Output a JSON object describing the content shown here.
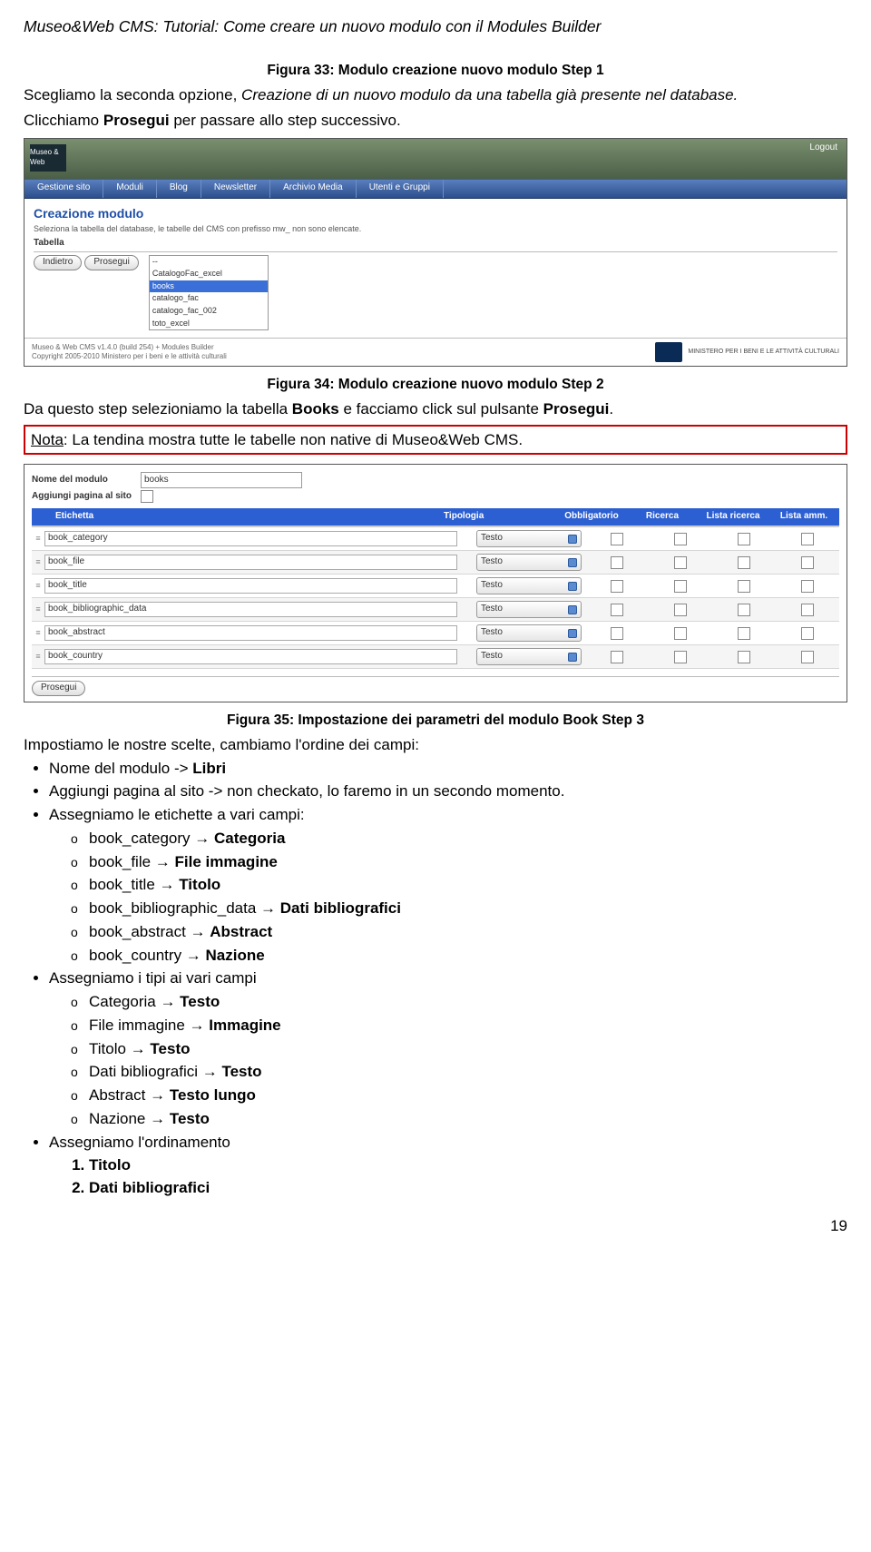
{
  "header": "Museo&Web CMS: Tutorial: Come creare un nuovo modulo con il Modules Builder",
  "fig33": "Figura 33: Modulo creazione nuovo modulo Step 1",
  "para1a": "Scegliamo la seconda opzione, ",
  "para1b": "Creazione di un nuovo modulo da una tabella già presente nel database.",
  "para2a": "Clicchiamo ",
  "para2b": "Prosegui",
  "para2c": " per passare allo step successivo.",
  "shot1": {
    "logo": "Museo & Web",
    "logout": "Logout",
    "nav": [
      "Gestione sito",
      "Moduli",
      "Blog",
      "Newsletter",
      "Archivio Media",
      "Utenti e Gruppi"
    ],
    "title": "Creazione modulo",
    "sub": "Seleziona la tabella del database, le tabelle del CMS con prefisso mw_ non sono elencate.",
    "label": "Tabella",
    "btn_back": "Indietro",
    "btn_next": "Prosegui",
    "dd_sel": "--",
    "dd_opts": [
      "CatalogoFac_excel",
      "books",
      "catalogo_fac",
      "catalogo_fac_002",
      "toto_excel"
    ],
    "footer_l1": "Museo & Web CMS v1.4.0 (build 254) + Modules Builder",
    "footer_l2": "Copyright 2005-2010 Ministero per i beni e le attività culturali",
    "mibac": "MINISTERO PER I BENI E LE ATTIVITÀ CULTURALI"
  },
  "fig34": "Figura 34: Modulo creazione nuovo modulo Step 2",
  "para3a": "Da questo step selezioniamo la tabella ",
  "para3b": "Books",
  "para3c": " e facciamo click sul pulsante ",
  "para3d": "Prosegui",
  "para3e": ".",
  "note_a": "Nota",
  "note_b": ": La tendina mostra tutte le tabelle non native di Museo&Web CMS.",
  "shot2": {
    "lbl_nome": "Nome del modulo",
    "val_nome": "books",
    "lbl_agg": "Aggiungi pagina al sito",
    "head": {
      "et": "Etichetta",
      "tp": "Tipologia",
      "ob": "Obbligatorio",
      "ri": "Ricerca",
      "lr": "Lista ricerca",
      "la": "Lista amm."
    },
    "rows": [
      {
        "et": "book_category",
        "tp": "Testo"
      },
      {
        "et": "book_file",
        "tp": "Testo"
      },
      {
        "et": "book_title",
        "tp": "Testo"
      },
      {
        "et": "book_bibliographic_data",
        "tp": "Testo"
      },
      {
        "et": "book_abstract",
        "tp": "Testo"
      },
      {
        "et": "book_country",
        "tp": "Testo"
      }
    ],
    "btn": "Prosegui"
  },
  "fig35": "Figura 35: Impostazione dei parametri del modulo Book Step 3",
  "para4": "Impostiamo le nostre scelte, cambiamo l'ordine dei campi:",
  "b1a": "Nome del modulo -> ",
  "b1b": "Libri",
  "b2": "Aggiungi pagina al sito -> non checkato, lo faremo in un secondo momento.",
  "b3": "Assegniamo le etichette a vari campi:",
  "b3_items": [
    {
      "l": "book_category",
      "r": "Categoria"
    },
    {
      "l": "book_file",
      "r": "File immagine"
    },
    {
      "l": "book_title",
      "r": "Titolo"
    },
    {
      "l": "book_bibliographic_data",
      "r": "Dati bibliografici"
    },
    {
      "l": "book_abstract",
      "r": "Abstract"
    },
    {
      "l": "book_country",
      "r": "Nazione"
    }
  ],
  "b4": "Assegniamo i tipi ai vari campi",
  "b4_items": [
    {
      "l": "Categoria",
      "r": "Testo"
    },
    {
      "l": "File immagine",
      "r": "Immagine"
    },
    {
      "l": "Titolo",
      "r": "Testo"
    },
    {
      "l": "Dati bibliografici",
      "r": "Testo"
    },
    {
      "l": "Abstract",
      "r": "Testo lungo"
    },
    {
      "l": "Nazione",
      "r": "Testo"
    }
  ],
  "b5": "Assegniamo l'ordinamento",
  "b5_items": [
    "Titolo",
    "Dati bibliografici"
  ],
  "pagenum": "19"
}
